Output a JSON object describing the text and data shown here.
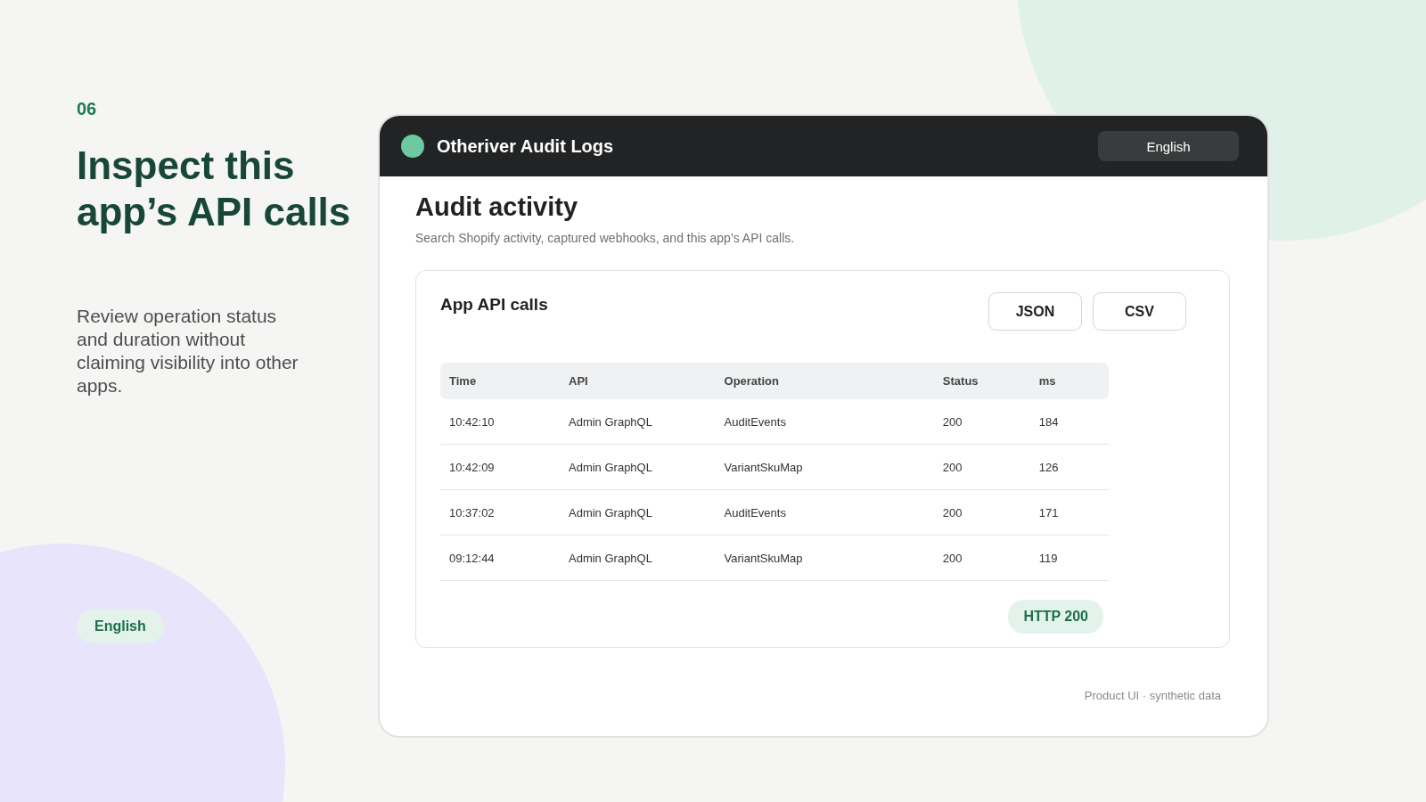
{
  "slide": {
    "number": "06",
    "heading": "Inspect this app’s API calls",
    "description": "Review operation status and duration without claiming visibility into other apps.",
    "language_badge": "English"
  },
  "app": {
    "title": "Otheriver Audit Logs",
    "language_button": "English",
    "page_title": "Audit activity",
    "page_subtitle": "Search Shopify activity, captured webhooks, and this app’s API calls.",
    "panel": {
      "title": "App API calls",
      "export_buttons": [
        "JSON",
        "CSV"
      ],
      "table": {
        "columns": [
          "Time",
          "API",
          "Operation",
          "Status",
          "ms"
        ],
        "rows": [
          [
            "10:42:10",
            "Admin GraphQL",
            "AuditEvents",
            "200",
            "184"
          ],
          [
            "10:42:09",
            "Admin GraphQL",
            "VariantSkuMap",
            "200",
            "126"
          ],
          [
            "10:37:02",
            "Admin GraphQL",
            "AuditEvents",
            "200",
            "171"
          ],
          [
            "09:12:44",
            "Admin GraphQL",
            "VariantSkuMap",
            "200",
            "119"
          ]
        ]
      },
      "status_badge": "HTTP 200"
    },
    "footer": "Product UI · synthetic data"
  }
}
